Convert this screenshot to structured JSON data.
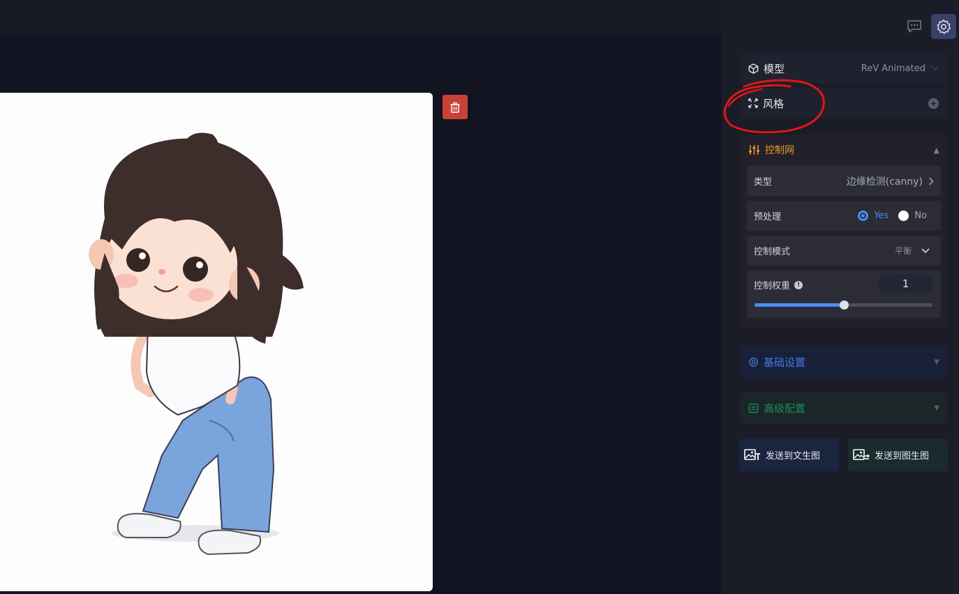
{
  "colors": {
    "accent_orange": "#e99632",
    "accent_blue": "#4a8df1",
    "delete_red": "#c94235",
    "annotation_red": "#e01616"
  },
  "icons": {
    "delete": "trash-icon",
    "chat": "chat-icon",
    "settings": "gear-icon",
    "model": "cube-icon",
    "style": "expand-icon",
    "controlnet": "sliders-icon",
    "basic": "gear-outline-icon",
    "advanced": "config-icon",
    "t2i": "image-text-icon",
    "i2i": "image-arrow-icon"
  },
  "model": {
    "label": "模型",
    "value": "ReV Animated"
  },
  "style": {
    "label": "风格"
  },
  "controlnet": {
    "title": "控制网",
    "type": {
      "label": "类型",
      "value": "边缘检测(canny)"
    },
    "preprocess": {
      "label": "预处理",
      "yes": "Yes",
      "no": "No",
      "selected": "Yes"
    },
    "mode": {
      "label": "控制模式",
      "value": "平衡"
    },
    "weight": {
      "label": "控制权重",
      "value": "1",
      "slider_fraction": 0.5
    }
  },
  "basic_settings": {
    "label": "基础设置"
  },
  "advanced_settings": {
    "label": "高级配置"
  },
  "actions": {
    "send_t2i": "发送到文生图",
    "send_i2i": "发送到图生图"
  }
}
